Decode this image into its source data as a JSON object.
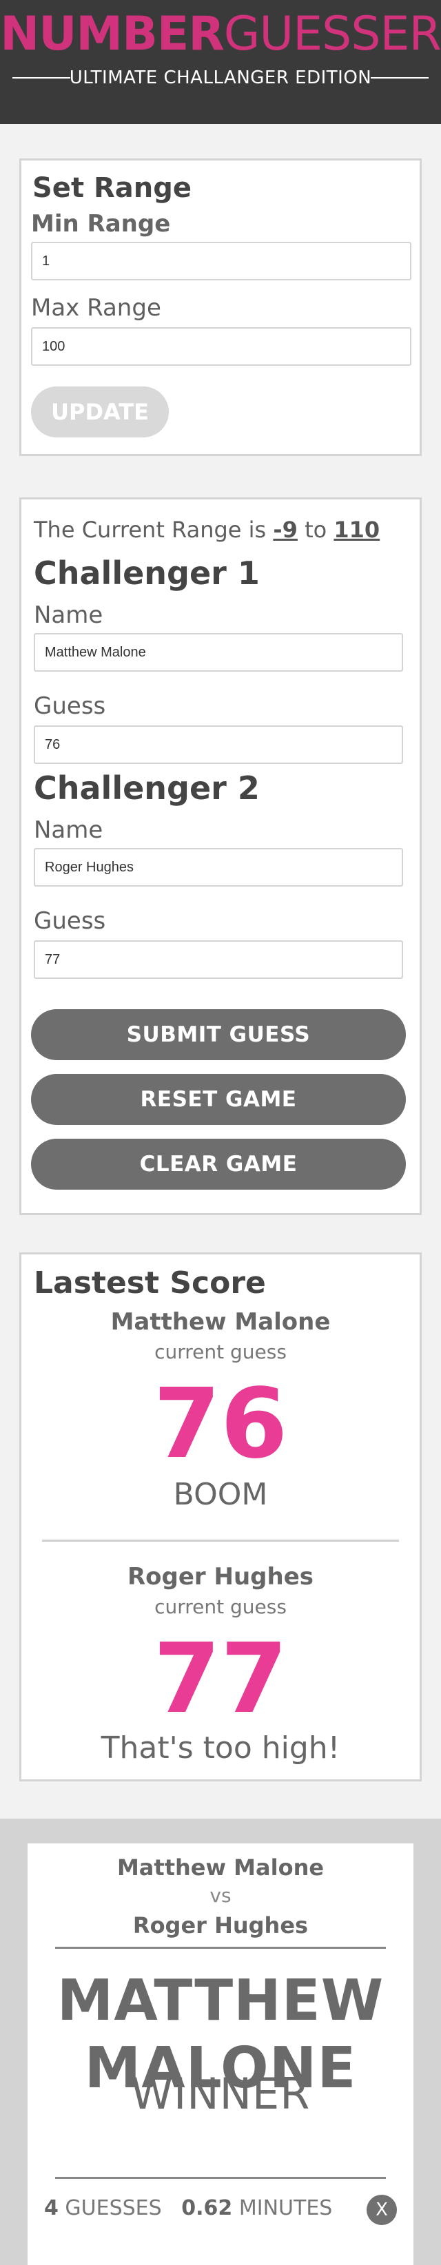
{
  "header": {
    "logo_strong": "NUMBER",
    "logo_light": "GUESSER",
    "tagline": "ULTIMATE CHALLANGER EDITION"
  },
  "range_card": {
    "title": "Set Range",
    "min_label": "Min Range",
    "min_value": "1",
    "max_label": "Max Range",
    "max_value": "100",
    "update_label": "UPDATE"
  },
  "challenger_card": {
    "range_prefix": "The Current Range is",
    "range_min": "-9",
    "range_sep": "to",
    "range_max": "110",
    "challenger1": {
      "title": "Challenger 1",
      "name_label": "Name",
      "name_value": "Matthew Malone",
      "guess_label": "Guess",
      "guess_value": "76"
    },
    "challenger2": {
      "title": "Challenger 2",
      "name_label": "Name",
      "name_value": "Roger Hughes",
      "guess_label": "Guess",
      "guess_value": "77"
    },
    "submit_label": "SUBMIT GUESS",
    "reset_label": "RESET GAME",
    "clear_label": "CLEAR GAME"
  },
  "score_card": {
    "title": "Lastest Score",
    "entries": [
      {
        "name": "Matthew Malone",
        "sub": "current guess",
        "guess": "76",
        "message": "BOOM"
      },
      {
        "name": "Roger Hughes",
        "sub": "current guess",
        "guess": "77",
        "message": "That's too high!"
      }
    ]
  },
  "winner_card": {
    "player1": "Matthew Malone",
    "vs": "vs",
    "player2": "Roger Hughes",
    "winner_line1": "MATTHEW",
    "winner_line2": "MALONE",
    "winner_label": "WINNER",
    "guess_count": "4",
    "guess_unit": "GUESSES",
    "minutes": "0.62",
    "minutes_unit": "MINUTES",
    "close_label": "X"
  }
}
